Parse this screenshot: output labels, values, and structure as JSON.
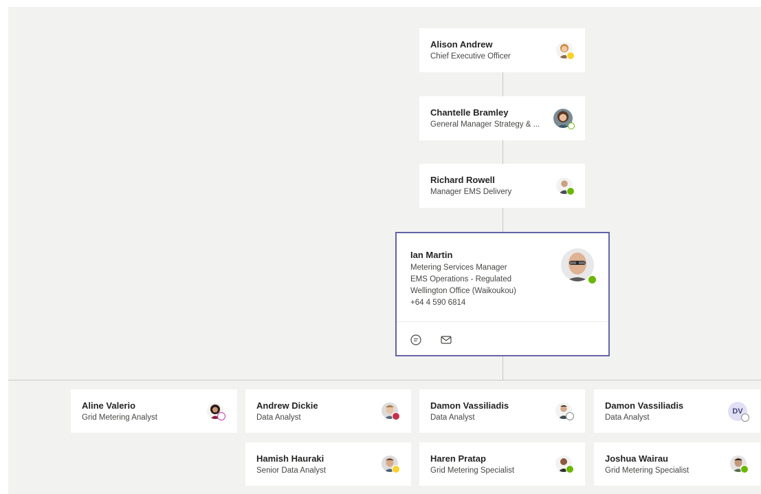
{
  "colors": {
    "background": "#f2f2f1",
    "card": "#ffffff",
    "selected_border": "#6264a7",
    "connector": "#c8c6c4",
    "available": "#6bb700",
    "away": "#f8d22a",
    "busy": "#c4314b",
    "dnd_purple": "#c239b3",
    "offline": "#8a8886"
  },
  "chain": [
    {
      "name": "Alison Andrew",
      "title": "Chief Executive Officer",
      "presence": "away"
    },
    {
      "name": "Chantelle Bramley",
      "title": "General Manager Strategy & ...",
      "presence": "available-outline"
    },
    {
      "name": "Richard Rowell",
      "title": "Manager EMS Delivery",
      "presence": "available"
    }
  ],
  "selected": {
    "name": "Ian Martin",
    "title": "Metering Services Manager",
    "department": "EMS Operations - Regulated",
    "office": "Wellington Office (Waikoukou)",
    "phone": "+64 4 590 6814",
    "presence": "available",
    "actions": [
      "chat-icon",
      "mail-icon"
    ]
  },
  "reports": [
    {
      "name": "Aline Valerio",
      "title": "Grid Metering Analyst",
      "presence": "out-of-office"
    },
    {
      "name": "Andrew Dickie",
      "title": "Data Analyst",
      "presence": "busy"
    },
    {
      "name": "Damon Vassiliadis",
      "title": "Data Analyst",
      "presence": "offline"
    },
    {
      "name": "Damon Vassiliadis",
      "title": "Data Analyst",
      "presence": "offline",
      "initials": "DV"
    },
    {
      "name": "Hamish Hauraki",
      "title": "Senior Data Analyst",
      "presence": "away"
    },
    {
      "name": "Haren Pratap",
      "title": "Grid Metering Specialist",
      "presence": "available"
    },
    {
      "name": "Joshua Wairau",
      "title": "Grid Metering Specialist",
      "presence": "available"
    }
  ]
}
